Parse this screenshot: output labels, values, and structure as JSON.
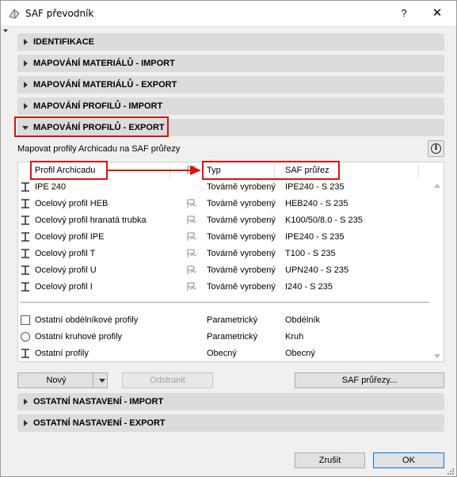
{
  "window": {
    "title": "SAF převodník",
    "help_label": "?",
    "close_label": "✕"
  },
  "sections": {
    "identifikace": "IDENTIFIKACE",
    "mat_import": "MAPOVÁNÍ MATERIÁLŮ - IMPORT",
    "mat_export": "MAPOVÁNÍ MATERIÁLŮ - EXPORT",
    "prof_import": "MAPOVÁNÍ PROFILŮ - IMPORT",
    "prof_export": "MAPOVÁNÍ PROFILŮ - EXPORT",
    "ost_import": "OSTATNÍ NASTAVENÍ - IMPORT",
    "ost_export": "OSTATNÍ NASTAVENÍ - EXPORT"
  },
  "profiles": {
    "description": "Mapovat profily Archicadu na SAF průřezy",
    "headers": {
      "archicad": "Profil Archicadu",
      "typ": "Typ",
      "saf": "SAF průřez"
    },
    "rows": [
      {
        "name": "IPE 240",
        "typ": "Továrně vyrobený",
        "saf": "IPE240 - S 235",
        "icon": "i-beam-icon",
        "flag": false
      },
      {
        "name": "Ocelový profil HEB",
        "typ": "Továrně vyrobený",
        "saf": "HEB240 - S 235",
        "icon": "i-beam-icon",
        "flag": true
      },
      {
        "name": "Ocelový profil hranatá trubka",
        "typ": "Továrně vyrobený",
        "saf": "K100/50/8.0 - S 235",
        "icon": "i-beam-icon",
        "flag": true
      },
      {
        "name": "Ocelový profil IPE",
        "typ": "Továrně vyrobený",
        "saf": "IPE240 - S 235",
        "icon": "i-beam-icon",
        "flag": true
      },
      {
        "name": "Ocelový profil T",
        "typ": "Továrně vyrobený",
        "saf": "T100 - S 235",
        "icon": "i-beam-icon",
        "flag": true
      },
      {
        "name": "Ocelový profil U",
        "typ": "Továrně vyrobený",
        "saf": "UPN240 - S 235",
        "icon": "i-beam-icon",
        "flag": true
      },
      {
        "name": "Ocelový profil I",
        "typ": "Továrně vyrobený",
        "saf": "I240 - S 235",
        "icon": "i-beam-icon",
        "flag": true
      }
    ],
    "other_rows": [
      {
        "name": "Ostatní obdélníkové profily",
        "typ": "Parametrický",
        "saf": "Obdélník",
        "icon": "rectangle-icon"
      },
      {
        "name": "Ostatní kruhové profily",
        "typ": "Parametrický",
        "saf": "Kruh",
        "icon": "circle-icon"
      },
      {
        "name": "Ostatní profily",
        "typ": "Obecný",
        "saf": "Obecný",
        "icon": "i-beam-icon"
      }
    ]
  },
  "buttons": {
    "new": "Nový",
    "remove": "Odstranit",
    "saf_sections": "SAF průřezy...",
    "cancel": "Zrušit",
    "ok": "OK"
  },
  "annotation_color": "#e01010"
}
